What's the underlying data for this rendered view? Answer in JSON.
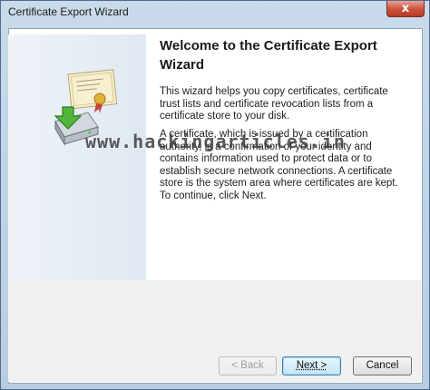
{
  "window": {
    "title": "Certificate Export Wizard",
    "close_glyph": "x"
  },
  "main": {
    "heading": "Welcome to the Certificate Export Wizard",
    "paragraphs": [
      "This wizard helps you copy certificates, certificate trust lists and certificate revocation lists from a certificate store to your disk.",
      "A certificate, which is issued by a certification authority, is a confirmation of your identity and contains information used to protect data or to establish secure network connections. A certificate store is the system area where certificates are kept.",
      "To continue, click Next."
    ],
    "watermark": "www.hackingarticles.in"
  },
  "buttons": {
    "back_label": "< Back",
    "next_label": "Next >",
    "cancel_label": "Cancel"
  },
  "icons": {
    "wizard_icon": "certificate-disk-export-icon"
  },
  "colors": {
    "frame": "#b8cde2",
    "close_button": "#c9503a",
    "default_button_border": "#3c7fb1"
  }
}
